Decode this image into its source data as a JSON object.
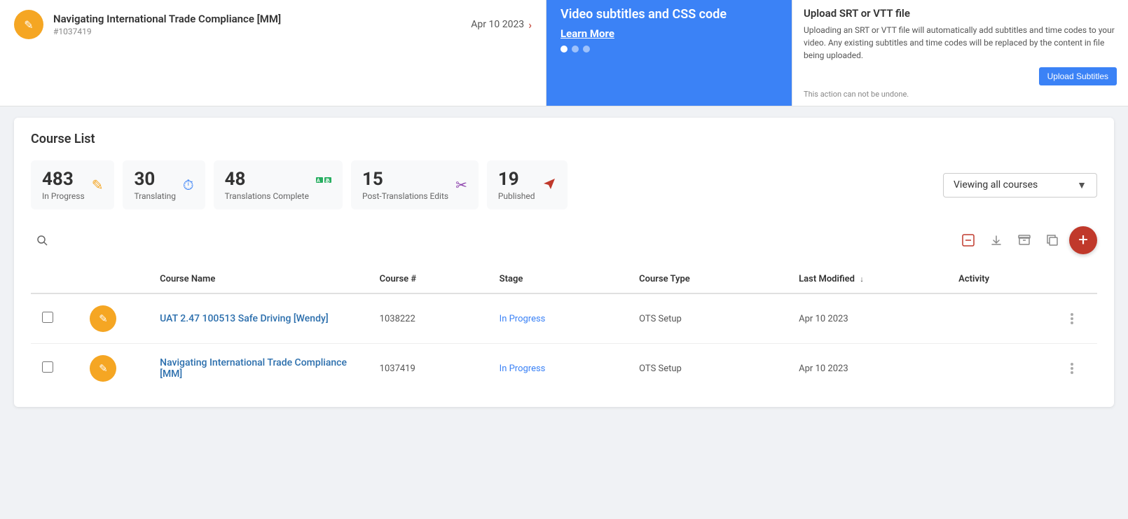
{
  "topCourse": {
    "title": "Navigating International Trade Compliance [MM]",
    "id": "#1037419",
    "date": "Apr 10 2023",
    "iconSymbol": "✎"
  },
  "banner": {
    "title": "Video subtitles and CSS code",
    "learnMore": "Learn More",
    "dots": [
      true,
      false,
      false
    ]
  },
  "uploadPanel": {
    "title": "Upload SRT or VTT file",
    "description": "Uploading an SRT or VTT file will automatically add subtitles and time codes to your video. Any existing subtitles and time codes will be replaced by the content in file being uploaded.",
    "actionNote": "This action can not be undone.",
    "uploadButton": "Upload Subtitles"
  },
  "courseList": {
    "sectionTitle": "Course List",
    "stats": [
      {
        "number": "483",
        "label": "In Progress",
        "icon": "✎",
        "iconClass": "icon-orange"
      },
      {
        "number": "30",
        "label": "Translating",
        "icon": "⏱",
        "iconClass": "icon-blue"
      },
      {
        "number": "48",
        "label": "Translations Complete",
        "icon": "🅰🅱",
        "iconClass": "icon-green"
      },
      {
        "number": "15",
        "label": "Post-Translations Edits",
        "icon": "✂",
        "iconClass": "icon-purple"
      },
      {
        "number": "19",
        "label": "Published",
        "icon": "✈",
        "iconClass": "icon-red"
      }
    ],
    "viewingLabel": "Viewing all courses",
    "dropdownArrow": "▼",
    "toolbar": {
      "searchPlaceholder": "Search...",
      "actions": [
        "minus-square",
        "download",
        "archive",
        "copy",
        "add"
      ]
    },
    "table": {
      "columns": [
        "",
        "",
        "Course Name",
        "Course #",
        "Stage",
        "Course Type",
        "Last Modified",
        "Activity",
        ""
      ],
      "rows": [
        {
          "id": 1,
          "iconSymbol": "✎",
          "name": "UAT 2.47 100513 Safe Driving [Wendy]",
          "number": "1038222",
          "stage": "In Progress",
          "type": "OTS Setup",
          "lastModified": "Apr 10 2023",
          "activity": ""
        },
        {
          "id": 2,
          "iconSymbol": "✎",
          "name": "Navigating International Trade Compliance [MM]",
          "number": "1037419",
          "stage": "In Progress",
          "type": "OTS Setup",
          "lastModified": "Apr 10 2023",
          "activity": ""
        }
      ]
    }
  }
}
